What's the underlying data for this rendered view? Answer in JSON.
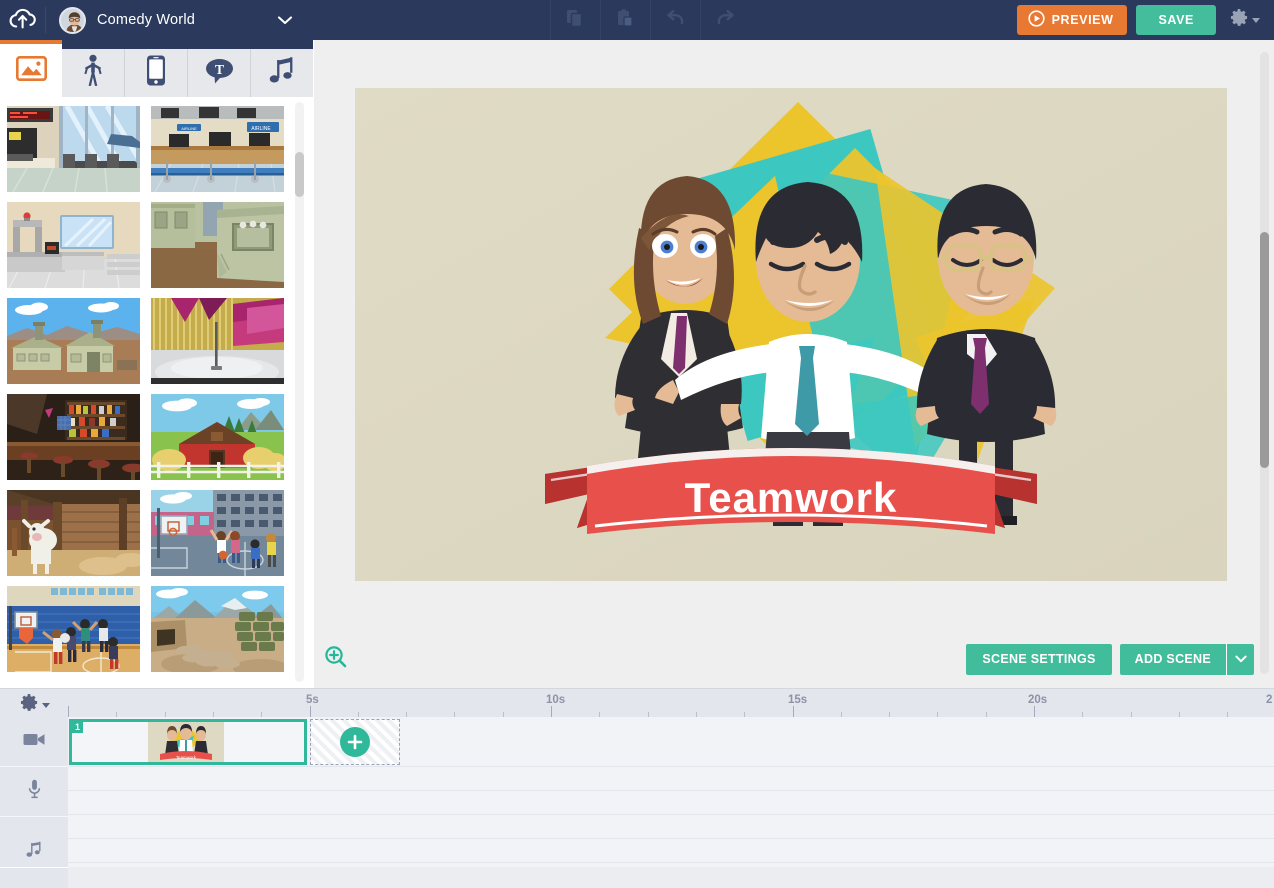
{
  "app": {
    "logo_icon": "cloud-upload-icon",
    "avatar_icon": "user-avatar",
    "project_title": "Comedy World",
    "title_caret_icon": "chevron-down-icon"
  },
  "toolbar": {
    "copy_icon": "copy-icon",
    "paste_icon": "paste-icon",
    "undo_icon": "undo-icon",
    "redo_icon": "redo-icon",
    "preview_label": "PREVIEW",
    "preview_icon": "play-circle-icon",
    "save_label": "SAVE",
    "settings_icon": "gear-icon",
    "settings_caret_icon": "caret-down-icon",
    "colors": {
      "topbar": "#2b3a5c",
      "preview": "#e87932",
      "save": "#43bd9b"
    }
  },
  "library": {
    "tabs": [
      {
        "name": "backgrounds",
        "icon": "image-icon",
        "active": true
      },
      {
        "name": "characters",
        "icon": "person-icon",
        "active": false
      },
      {
        "name": "props",
        "icon": "phone-icon",
        "active": false
      },
      {
        "name": "text",
        "icon": "text-bubble-icon",
        "active": false
      },
      {
        "name": "audio",
        "icon": "music-note-icon",
        "active": false
      }
    ],
    "thumbnails": [
      [
        {
          "name": "airport-terminal-lounge"
        },
        {
          "name": "airline-check-in-counters"
        }
      ],
      [
        {
          "name": "airport-security-scanner"
        },
        {
          "name": "army-tent-interior"
        }
      ],
      [
        {
          "name": "military-barracks-desert"
        },
        {
          "name": "tv-studio-stage"
        }
      ],
      [
        {
          "name": "bar-interior-night"
        },
        {
          "name": "red-barn-farm"
        }
      ],
      [
        {
          "name": "cow-in-stable"
        },
        {
          "name": "outdoor-basketball-court"
        }
      ],
      [
        {
          "name": "indoor-basketball-gym"
        },
        {
          "name": "desert-sandbag-bunker"
        }
      ]
    ],
    "scrollbar": {
      "name": "library-scrollbar"
    }
  },
  "stage": {
    "scene_title": "Teamwork",
    "background_color": "#ded9c3",
    "banner_color": "#e8504c",
    "accent_yellow": "#ecc42c",
    "accent_teal": "#3cc8c0",
    "zoom_icon": "zoom-in-icon",
    "scene_settings_label": "SCENE SETTINGS",
    "add_scene_label": "ADD SCENE",
    "add_scene_caret_icon": "chevron-down-icon",
    "scrollbar": {
      "name": "stage-scrollbar"
    }
  },
  "timeline": {
    "settings_icon": "gear-icon",
    "settings_caret_icon": "caret-down-icon",
    "ruler_labels": [
      "5s",
      "10s",
      "15s",
      "20s",
      "2"
    ],
    "tracks": [
      {
        "name": "video-track",
        "icon": "video-camera-icon"
      },
      {
        "name": "voice-track",
        "icon": "microphone-icon"
      },
      {
        "name": "music-track",
        "icon": "music-note-icon"
      }
    ],
    "clips": [
      {
        "name": "scene-clip-1",
        "number": "1",
        "thumbnail": "teamwork-scene"
      }
    ],
    "add_clip": {
      "name": "add-scene-placeholder",
      "icon": "plus-icon"
    },
    "colors": {
      "clip_border": "#2fb89a",
      "track_bg": "#f1f3f7"
    }
  }
}
